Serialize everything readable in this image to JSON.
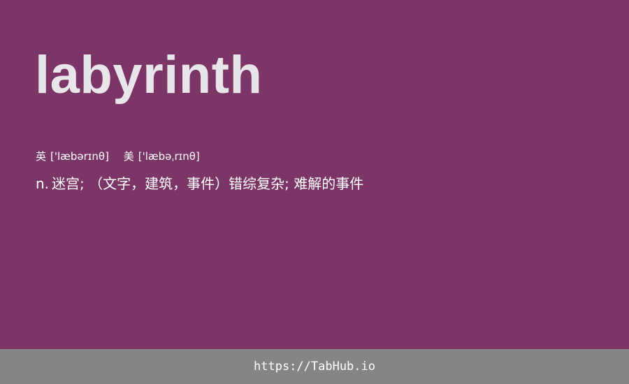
{
  "word": "labyrinth",
  "phonetics": {
    "uk_label": "英",
    "uk_ipa": "['læbərɪnθ]",
    "us_label": "美",
    "us_ipa": "['læbəˌrɪnθ]"
  },
  "definition": {
    "part_of_speech": "n.",
    "text": "迷宫; （文字，建筑，事件）错综复杂; 难解的事件"
  },
  "footer": {
    "link_text": "https://TabHub.io"
  },
  "colors": {
    "background": "#7b3566",
    "word_text": "#e8e6ea",
    "footer_background": "#858585",
    "footer_text": "#ffffff"
  }
}
